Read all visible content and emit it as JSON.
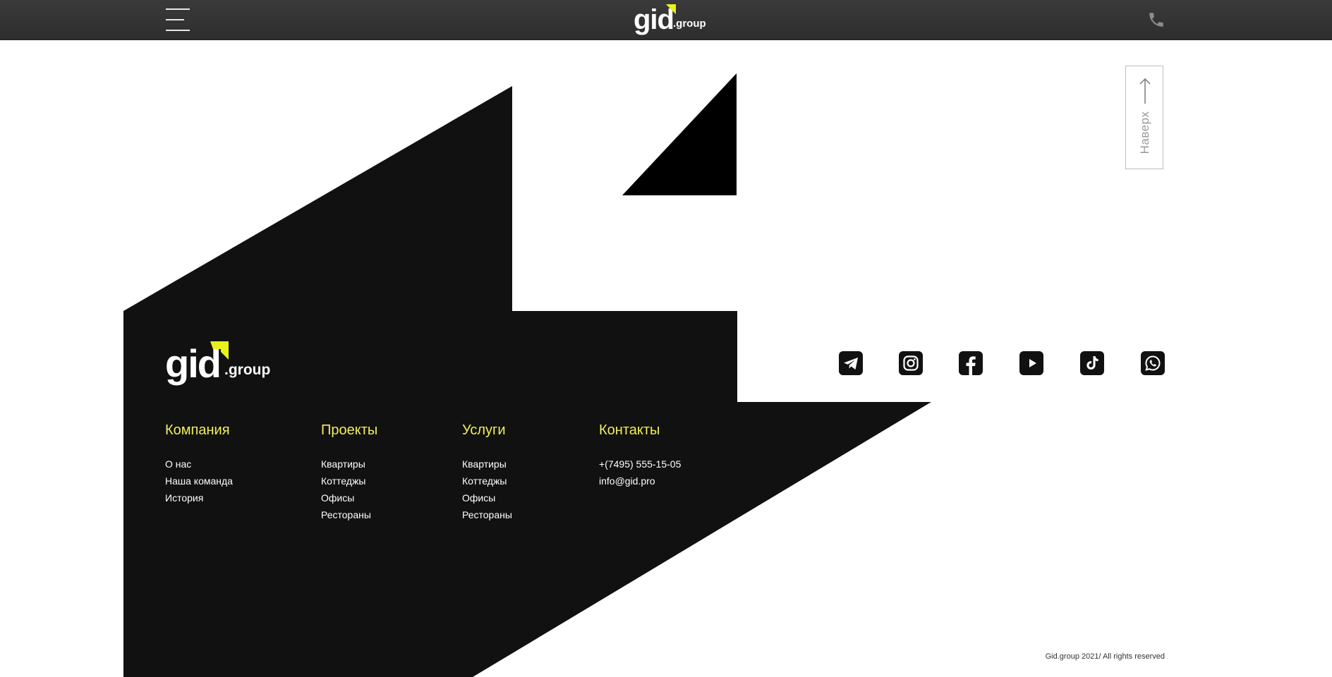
{
  "header": {
    "logo_main": "gid",
    "logo_suffix": ".group",
    "menu_icon": "hamburger-menu-icon",
    "phone_icon": "phone-icon"
  },
  "scroll_top": {
    "label": "Наверх",
    "icon": "arrow-up-icon"
  },
  "footer": {
    "logo_main": "gid",
    "logo_suffix": ".group",
    "columns": [
      {
        "title": "Компания",
        "links": [
          "О нас",
          "Наша команда",
          "История"
        ]
      },
      {
        "title": "Проекты",
        "links": [
          "Квартиры",
          "Коттеджы",
          "Офисы",
          "Рестораны"
        ]
      },
      {
        "title": "Услуги",
        "links": [
          "Квартиры",
          "Коттеджы",
          "Офисы",
          "Рестораны"
        ]
      },
      {
        "title": "Контакты",
        "links": [
          "+(7495) 555-15-05",
          "info@gid.pro"
        ]
      }
    ],
    "socials": [
      "telegram-icon",
      "instagram-icon",
      "facebook-icon",
      "youtube-icon",
      "tiktok-icon",
      "whatsapp-icon"
    ],
    "copyright": "Gid.group 2021/ All rights reserved"
  },
  "colors": {
    "accent": "#f2ef5a",
    "logo_mark": "#e8f21a",
    "dark": "#111111",
    "topbar": "#333333"
  }
}
